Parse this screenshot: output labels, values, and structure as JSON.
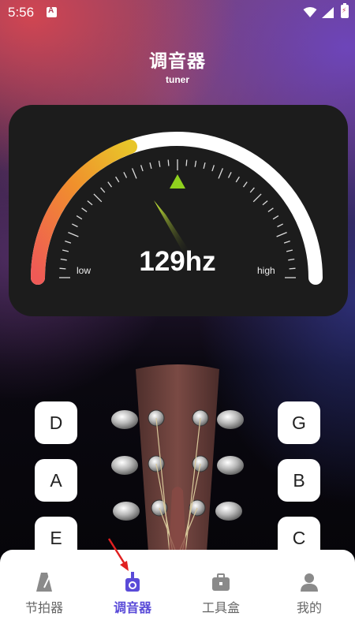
{
  "status_bar": {
    "time": "5:56"
  },
  "header": {
    "title": "调音器",
    "subtitle": "tuner"
  },
  "tuner": {
    "frequency": "129hz",
    "low_label": "low",
    "high_label": "high"
  },
  "strings": {
    "left": [
      "D",
      "A",
      "E"
    ],
    "right": [
      "G",
      "B",
      "C"
    ]
  },
  "nav": {
    "items": [
      {
        "label": "节拍器",
        "icon": "metronome-icon"
      },
      {
        "label": "调音器",
        "icon": "tuner-icon"
      },
      {
        "label": "工具盒",
        "icon": "toolbox-icon"
      },
      {
        "label": "我的",
        "icon": "user-icon"
      }
    ],
    "active_index": 1
  },
  "colors": {
    "accent": "#5a4bd8",
    "indicator": "#8fd11e",
    "gauge_warm_start": "#ef5a56",
    "gauge_warm_end": "#f0c02c"
  }
}
